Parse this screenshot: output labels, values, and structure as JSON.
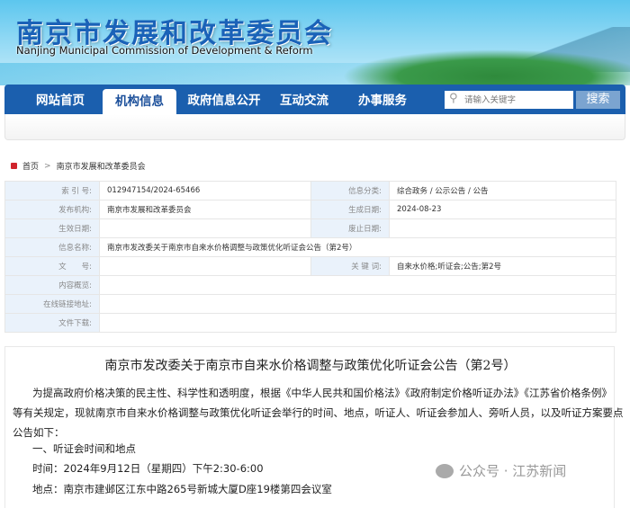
{
  "header": {
    "title_cn": "南京市发展和改革委员会",
    "title_en": "Nanjing Municipal Commission of Development & Reform"
  },
  "nav": {
    "items": [
      "网站首页",
      "机构信息",
      "政府信息公开",
      "互动交流",
      "办事服务"
    ],
    "active": "机构信息"
  },
  "search": {
    "placeholder": "请输入关键字",
    "button": "搜索"
  },
  "breadcrumb": {
    "home": "首页",
    "sep": ">",
    "current": "南京市发展和改革委员会"
  },
  "meta": {
    "index_label": "索 引 号:",
    "index": "012947154/2024-65466",
    "category_label": "信息分类:",
    "category": "综合政务 / 公示公告 / 公告",
    "publisher_label": "发布机构:",
    "publisher": "南京市发展和改革委员会",
    "created_label": "生成日期:",
    "created": "2024-08-23",
    "effective_label": "生效日期:",
    "effective": "",
    "expire_label": "废止日期:",
    "expire": "",
    "name_label": "信息名称:",
    "name": "南京市发改委关于南京市自来水价格调整与政策优化听证会公告（第2号）",
    "docno_label": "文　　号:",
    "docno": "",
    "keywords_label": "关 键 词:",
    "keywords": "自来水价格;听证会;公告;第2号",
    "overview_label": "内容概览:",
    "link_label": "在线链接地址:",
    "download_label": "文件下载:"
  },
  "article": {
    "title": "南京市发改委关于南京市自来水价格调整与政策优化听证会公告（第2号）",
    "p1a": "为提高政府价格决策的民主性、科学性和透明度，根据《中华人民共和国价格法》《政府制定价格听证办法》《江苏省价格条例》",
    "p1b": "等有关规定，现就南京市自来水价格调整与政策优化听证会举行的时间、地点，听证人、听证会参加人、旁听人员，以及听证方案要点",
    "p1c": "公告如下：",
    "s1": "一、听证会时间和地点",
    "time": "时间：2024年9月12日（星期四）下午2:30-6:00",
    "place": "地点：南京市建邺区江东中路265号新城大厦D座19楼第四会议室"
  },
  "watermark": "公众号 · 江苏新闻"
}
